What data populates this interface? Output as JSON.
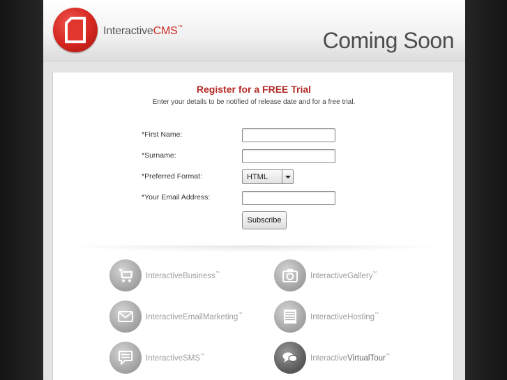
{
  "header": {
    "logo_text_main": "Interactive",
    "logo_text_accent": "CMS",
    "logo_tm": "™",
    "coming_soon": "Coming Soon"
  },
  "form": {
    "title": "Register for a FREE Trial",
    "subtitle": "Enter your details to be notified of release date and for a free trial.",
    "first_name_label": "*First Name:",
    "first_name_value": "",
    "surname_label": "*Surname:",
    "surname_value": "",
    "format_label": "*Preferred Format:",
    "format_value": "HTML",
    "email_label": "*Your Email Address:",
    "email_value": "",
    "subscribe_label": "Subscribe"
  },
  "products": [
    {
      "prefix": "Interactive",
      "suffix": "Business",
      "tm": "™",
      "icon": "cart-icon"
    },
    {
      "prefix": "Interactive",
      "suffix": "Gallery",
      "tm": "™",
      "icon": "camera-icon"
    },
    {
      "prefix": "Interactive",
      "suffix": "EmailMarketing",
      "tm": "™",
      "icon": "envelope-icon"
    },
    {
      "prefix": "Interactive",
      "suffix": "Hosting",
      "tm": "™",
      "icon": "server-icon"
    },
    {
      "prefix": "Interactive",
      "suffix": "SMS",
      "tm": "™",
      "icon": "message-icon"
    },
    {
      "prefix": "Interactive",
      "suffix": "VirtualTour",
      "tm": "™",
      "icon": "chat-bubbles-icon"
    }
  ],
  "colors": {
    "brand_red": "#d02a22",
    "title_red": "#b22b27",
    "background_dark": "#262626"
  }
}
